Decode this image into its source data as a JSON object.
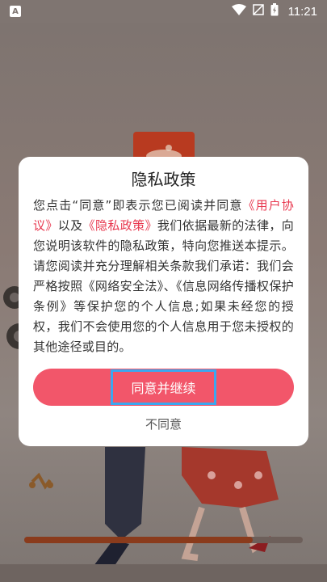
{
  "status_bar": {
    "app_badge": "A",
    "time": "11:21",
    "icons": [
      "wifi-icon",
      "no-sim-icon",
      "battery-charging-icon"
    ]
  },
  "dialog": {
    "title": "隐私政策",
    "body_parts": {
      "p1": "您点击“同意”即表示您已阅读并同意",
      "link_user_agreement": "《用户协议》",
      "p2": "以及",
      "link_privacy_policy": "《隐私政策》",
      "p3": "我们依据最新的法律，向您说明该软件的隐私政策，特向您推送本提示。请您阅读并充分理解相关条款我们承诺：我们会严格按照《网络安全法》、《信息网络传播权保护条例》等保护您的个人信息;如果未经您的授权，我们不会使用您的个人信息用于您未授权的其他途径或目的。"
    },
    "agree_label": "同意并继续",
    "disagree_label": "不同意"
  },
  "background": {
    "loading_progress": 0.82,
    "colors": {
      "overlay": "#7f7571",
      "accent": "#f2566a",
      "link": "#e8384f",
      "highlight_border": "#3aa8f0"
    }
  }
}
